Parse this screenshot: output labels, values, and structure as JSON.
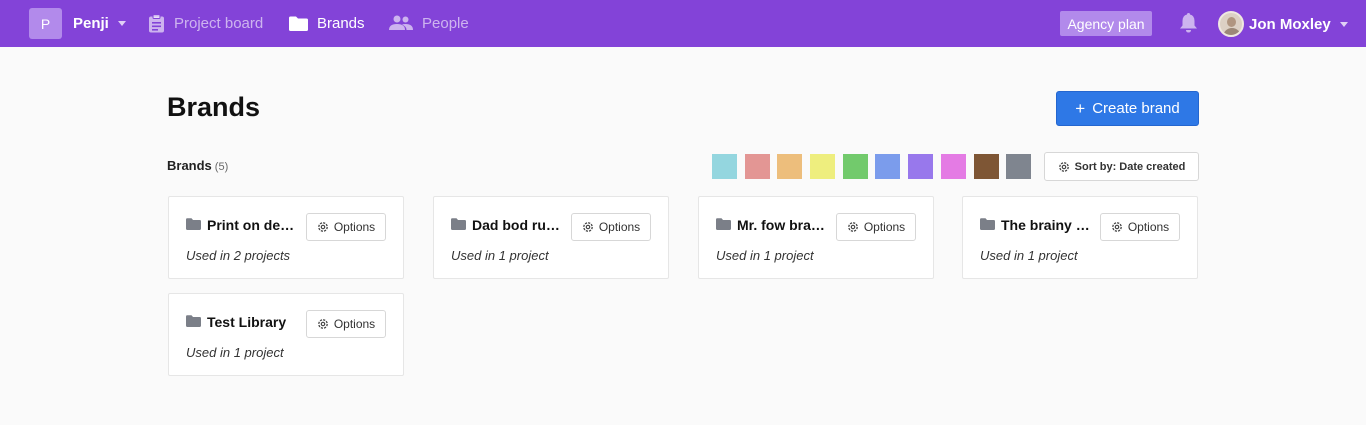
{
  "nav": {
    "workspace_initial": "P",
    "workspace_name": "Penji",
    "items": [
      {
        "label": "Project board",
        "icon": "clipboard-icon",
        "active": false
      },
      {
        "label": "Brands",
        "icon": "folder-icon",
        "active": true
      },
      {
        "label": "People",
        "icon": "people-icon",
        "active": false
      }
    ],
    "plan_badge": "Agency plan",
    "user_name": "Jon Moxley"
  },
  "page": {
    "title": "Brands",
    "create_button": "Create brand",
    "create_icon": "+",
    "section_label": "Brands",
    "section_count": "(5)",
    "sort_button": "Sort by: Date created"
  },
  "color_filters": [
    "#94d6df",
    "#e39694",
    "#edbe7c",
    "#eeee7e",
    "#72ca6c",
    "#7b9cec",
    "#9878ec",
    "#e47be4",
    "#7e5635",
    "#7f858f"
  ],
  "brands": [
    {
      "name": "Print on de…",
      "usage": "Used in 2 projects",
      "options_label": "Options"
    },
    {
      "name": "Dad bod run…",
      "usage": "Used in 1 project",
      "options_label": "Options"
    },
    {
      "name": "Mr. fow bran…",
      "usage": "Used in 1 project",
      "options_label": "Options"
    },
    {
      "name": "The brainy b…",
      "usage": "Used in 1 project",
      "options_label": "Options"
    },
    {
      "name": "Test Library",
      "usage": "Used in 1 project",
      "options_label": "Options"
    }
  ],
  "colors": {
    "nav_background": "#8343d8",
    "accent_light": "#b28aeb",
    "primary_button": "#2e78e6",
    "folder_gray": "#7b7f88"
  }
}
